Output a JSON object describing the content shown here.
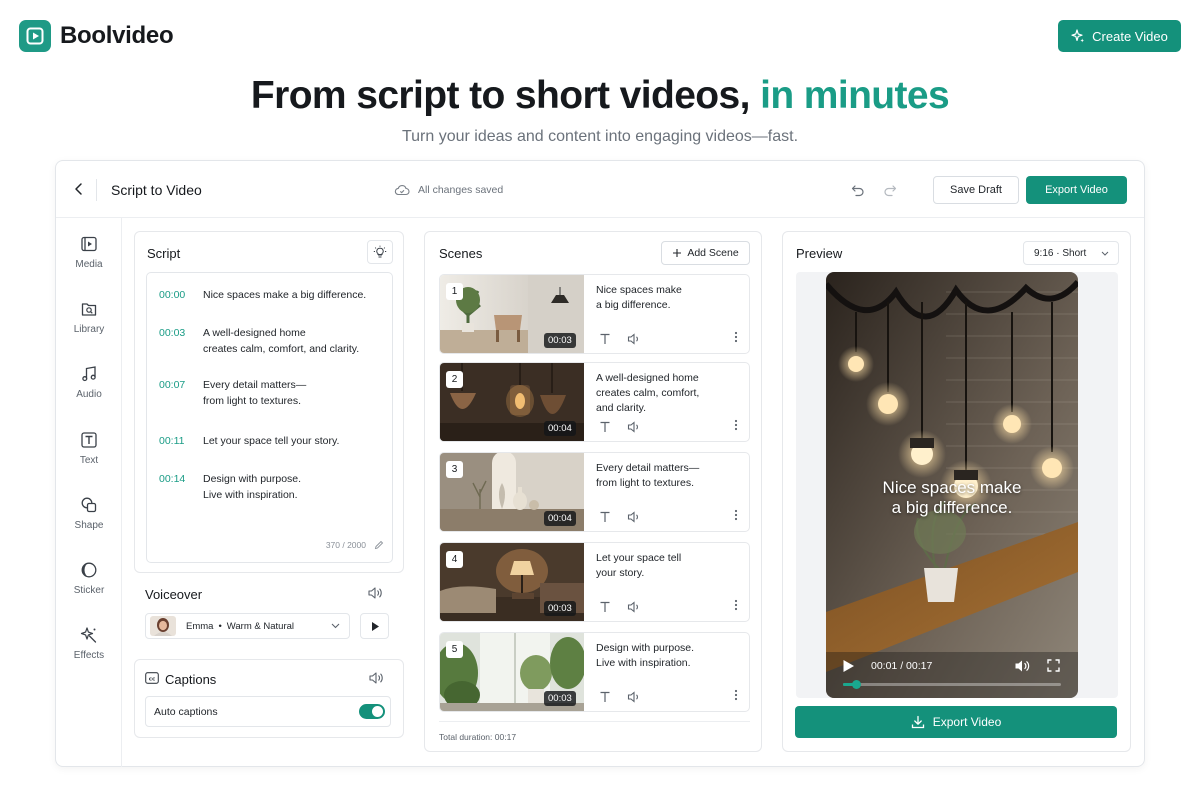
{
  "brand": {
    "name": "Boolvideo",
    "accent": "#14917b"
  },
  "header": {
    "create_label": "Create Video"
  },
  "hero": {
    "title_main": "From script to short videos, ",
    "title_accent": "in minutes",
    "subtitle": "Turn your ideas and content into engaging videos—fast."
  },
  "editor": {
    "title": "Script to Video",
    "status": "All changes saved",
    "save_draft_label": "Save Draft",
    "export_label": "Export Video"
  },
  "sidebar": {
    "items": [
      {
        "label": "Media",
        "icon": "media-icon"
      },
      {
        "label": "Library",
        "icon": "library-icon"
      },
      {
        "label": "Audio",
        "icon": "audio-icon"
      },
      {
        "label": "Text",
        "icon": "text-icon"
      },
      {
        "label": "Shape",
        "icon": "shape-icon"
      },
      {
        "label": "Sticker",
        "icon": "sticker-icon"
      },
      {
        "label": "Effects",
        "icon": "effects-icon"
      }
    ]
  },
  "script": {
    "title": "Script",
    "lines": [
      {
        "time": "00:00",
        "l1": "Nice spaces make a big difference.",
        "l2": ""
      },
      {
        "time": "00:03",
        "l1": "A well-designed home",
        "l2": "creates calm, comfort, and clarity."
      },
      {
        "time": "00:07",
        "l1": "Every detail matters—",
        "l2": "from light to textures."
      },
      {
        "time": "00:11",
        "l1": "Let your space tell your story.",
        "l2": ""
      },
      {
        "time": "00:14",
        "l1": "Design with purpose.",
        "l2": "Live with inspiration."
      }
    ],
    "char_count": "370 / 2000"
  },
  "voiceover": {
    "title": "Voiceover",
    "voice_name": "Emma",
    "voice_style": "Warm & Natural"
  },
  "captions": {
    "title": "Captions",
    "auto_label": "Auto captions",
    "auto_enabled": true
  },
  "scenes": {
    "title": "Scenes",
    "add_label": "Add Scene",
    "items": [
      {
        "num": "1",
        "duration": "00:03",
        "l1": "Nice spaces make",
        "l2": "a big difference.",
        "l3": ""
      },
      {
        "num": "2",
        "duration": "00:04",
        "l1": "A well-designed home",
        "l2": "creates calm, comfort,",
        "l3": "and clarity."
      },
      {
        "num": "3",
        "duration": "00:04",
        "l1": "Every detail matters—",
        "l2": "from light to textures.",
        "l3": ""
      },
      {
        "num": "4",
        "duration": "00:03",
        "l1": "Let your space tell",
        "l2": "your story.",
        "l3": ""
      },
      {
        "num": "5",
        "duration": "00:03",
        "l1": "Design with purpose.",
        "l2": "Live with inspiration.",
        "l3": ""
      }
    ],
    "total_label": "Total duration:",
    "total_value": "00:17"
  },
  "preview": {
    "title": "Preview",
    "aspect_label": "9:16 · Short",
    "caption_l1": "Nice spaces make",
    "caption_l2": "a big difference.",
    "current_time": "00:01",
    "total_time": "00:17",
    "progress": 0.06,
    "export_label": "Export Video"
  }
}
